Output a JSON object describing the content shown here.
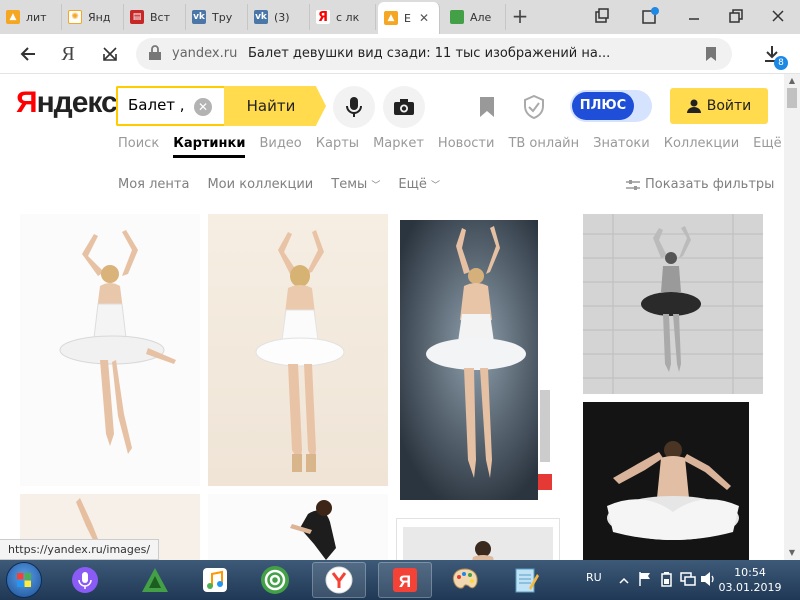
{
  "browser": {
    "tabs": [
      {
        "label": "лит",
        "icon": "image-favicon"
      },
      {
        "label": "Янд",
        "icon": "yandex-zen-favicon"
      },
      {
        "label": "Вст",
        "icon": "page-favicon"
      },
      {
        "label": "Тру",
        "icon": "vk-favicon"
      },
      {
        "label": "(3) ",
        "icon": "vk-favicon"
      },
      {
        "label": "с лк",
        "icon": "yandex-favicon"
      },
      {
        "label": "Е",
        "icon": "image-favicon",
        "active": true
      },
      {
        "label": "Але",
        "icon": "green-favicon"
      }
    ],
    "new_tab_symbol": "+",
    "address": {
      "domain": "yandex.ru",
      "title": "Балет девушки вид сзади: 11 тыс изображений на..."
    },
    "downloads_badge": "8"
  },
  "header": {
    "logo_primary": "Я",
    "logo_rest": "ндекс",
    "search_value": "Балет ,",
    "search_button": "Найти",
    "plus_label": "ПЛЮС",
    "login_label": "Войти"
  },
  "service_tabs": [
    "Поиск",
    "Картинки",
    "Видео",
    "Карты",
    "Маркет",
    "Новости",
    "ТВ онлайн",
    "Знатоки",
    "Коллекции",
    "Ещё"
  ],
  "subnav": {
    "my_feed": "Моя лента",
    "my_collections": "Мои коллекции",
    "topics": "Темы",
    "more": "Ещё",
    "show_filters": "Показать фильтры"
  },
  "status_url": "https://yandex.ru/images/",
  "taskbar": {
    "language": "RU",
    "time": "10:54",
    "date": "03.01.2019"
  },
  "colors": {
    "yandex_red": "#ff0000",
    "yandex_yellow": "#ffdb4d",
    "plus_blue": "#1f4fd8",
    "taskbar": "#2b4867"
  }
}
